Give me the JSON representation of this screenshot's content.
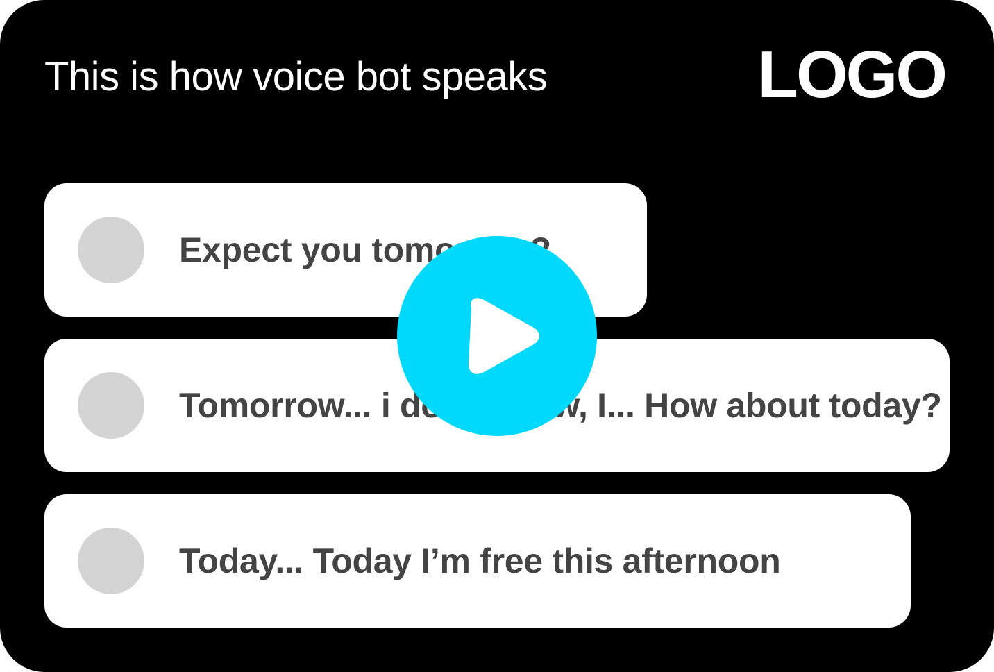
{
  "header": {
    "title": "This is how voice bot speaks",
    "logo": "LOGO"
  },
  "messages": [
    {
      "text": "Expect you tomorrow?"
    },
    {
      "text": "Tomorrow... i don't know, I... How about today?"
    },
    {
      "text": "Today... Today I’m free this afternoon"
    }
  ],
  "player": {
    "icon": "play-icon",
    "color": "#00d8fc"
  },
  "colors": {
    "background": "#000000",
    "bubble": "#ffffff",
    "avatar": "#d4d4d4",
    "text": "#444444"
  }
}
